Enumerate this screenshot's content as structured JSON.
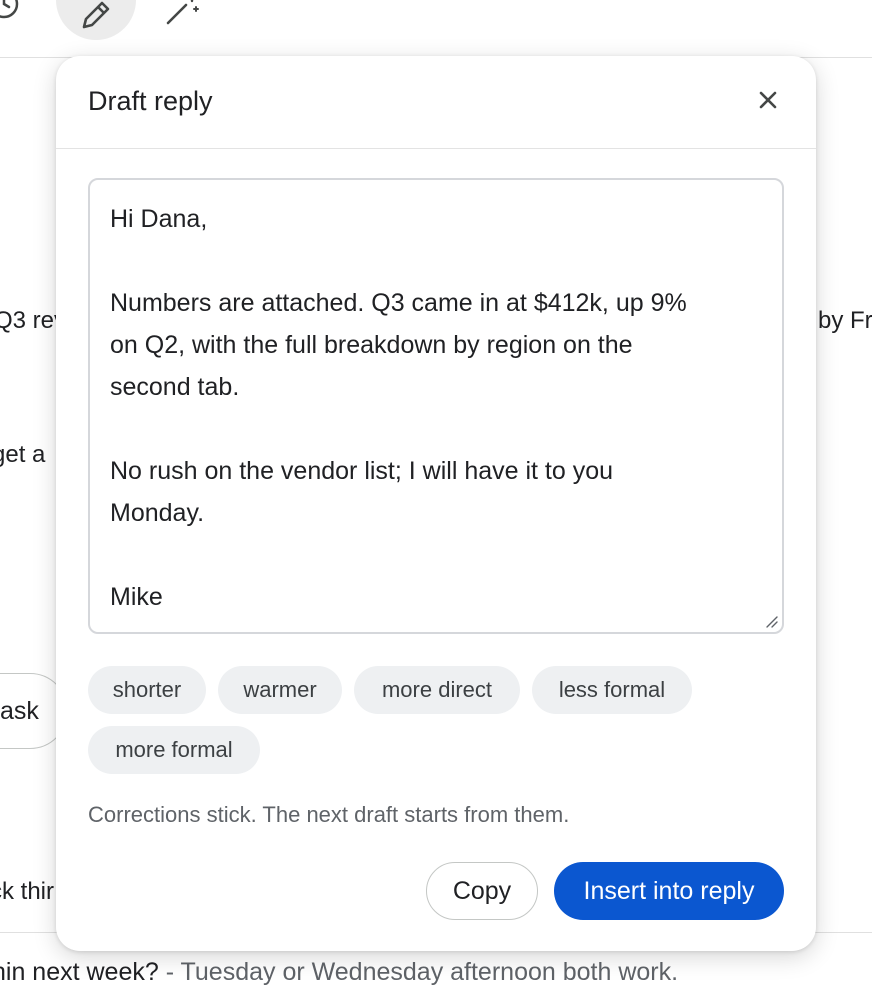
{
  "toolbar": {
    "history_icon": "history-icon",
    "edit_icon": "pencil-icon",
    "magic_icon": "magic-wand-icon"
  },
  "background": {
    "fragment_1_left": "Q3 rev",
    "fragment_1_right": "by Fr",
    "fragment_2": "get a",
    "task_button": "ask",
    "fragment_3": "ck thir",
    "bottom_subject": "hin next week?",
    "bottom_snippet": " - Tuesday or Wednesday afternoon both work."
  },
  "dialog": {
    "title": "Draft reply",
    "close_icon": "close-icon",
    "draft_lines": [
      "Hi Dana,",
      "",
      "Numbers are attached. Q3 came in at $412k, up 9%",
      "on Q2, with the full breakdown by region on the",
      "second tab.",
      "",
      "No rush on the vendor list; I will have it to you",
      "Monday.",
      "",
      "Mike"
    ],
    "chips": [
      "shorter",
      "warmer",
      "more direct",
      "less formal",
      "more formal"
    ],
    "note": "Corrections stick. The next draft starts from them.",
    "copy_label": "Copy",
    "insert_label": "Insert into reply"
  },
  "colors": {
    "primary": "#0b57d0",
    "chip_bg": "#eef0f2",
    "muted_text": "#5f6368"
  }
}
